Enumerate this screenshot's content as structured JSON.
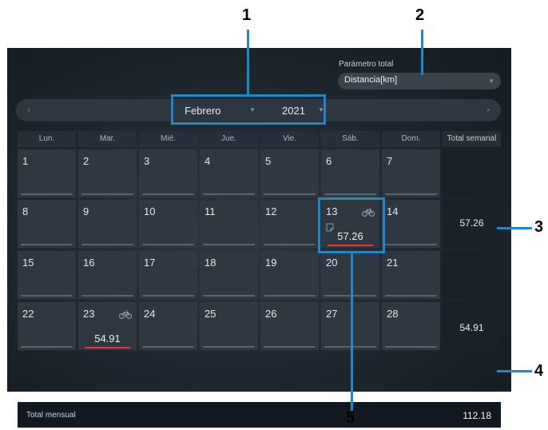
{
  "filter": {
    "label": "Parámetro total",
    "value": "Distancia[km]",
    "arrow": "▼"
  },
  "nav": {
    "prev": "‹",
    "next": "›",
    "month": "Febrero",
    "year": "2021",
    "arrow": "▼"
  },
  "days": [
    "Lun.",
    "Mar.",
    "Mié.",
    "Jue.",
    "Vie.",
    "Sáb.",
    "Dom."
  ],
  "total_header": "Total semanal",
  "weeks": [
    {
      "dates": [
        "1",
        "2",
        "3",
        "4",
        "5",
        "6",
        "7"
      ],
      "total": ""
    },
    {
      "dates": [
        "8",
        "9",
        "10",
        "11",
        "12",
        "13",
        "14"
      ],
      "total": "57.26"
    },
    {
      "dates": [
        "15",
        "16",
        "17",
        "18",
        "19",
        "20",
        "21"
      ],
      "total": ""
    },
    {
      "dates": [
        "22",
        "23",
        "24",
        "25",
        "26",
        "27",
        "28"
      ],
      "total": "54.91"
    }
  ],
  "activities": [
    {
      "date": "13",
      "value": "57.26",
      "icons": [
        "bicycle-icon",
        "note-icon"
      ]
    },
    {
      "date": "23",
      "value": "54.91",
      "icons": [
        "bicycle-icon"
      ]
    }
  ],
  "monthly": {
    "label": "Total mensual",
    "value": "112.18"
  },
  "callouts": [
    "1",
    "2",
    "3",
    "4",
    "5"
  ],
  "colors": {
    "accent": "#1e88c8",
    "underline": "#e03a3a",
    "panel": "#1d262e",
    "cell": "#2f3841"
  }
}
